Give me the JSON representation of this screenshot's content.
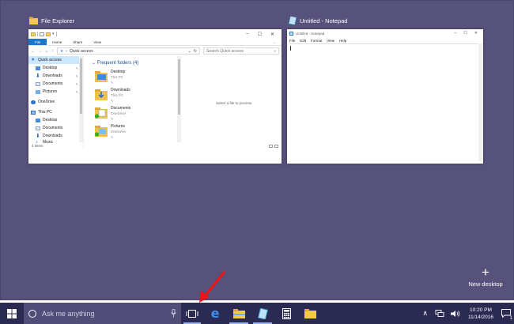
{
  "explorer": {
    "window_title": "File Explorer",
    "ribbon_tabs": [
      "File",
      "Home",
      "Share",
      "View"
    ],
    "address": "Quick access",
    "search_placeholder": "Search Quick access",
    "nav_items": [
      {
        "label": "Quick access",
        "icon": "star-icon",
        "pin": false,
        "selected": true,
        "level": 0
      },
      {
        "label": "Desktop",
        "icon": "desktop-folder-icon",
        "pin": true,
        "selected": false,
        "level": 1
      },
      {
        "label": "Downloads",
        "icon": "downloads-icon",
        "pin": true,
        "selected": false,
        "level": 1
      },
      {
        "label": "Documents",
        "icon": "documents-icon",
        "pin": true,
        "selected": false,
        "level": 1
      },
      {
        "label": "Pictures",
        "icon": "pictures-icon",
        "pin": true,
        "selected": false,
        "level": 1
      },
      {
        "label": "OneDrive",
        "icon": "onedrive-icon",
        "pin": false,
        "selected": false,
        "level": 0
      },
      {
        "label": "This PC",
        "icon": "computer-icon",
        "pin": false,
        "selected": false,
        "level": 0
      },
      {
        "label": "Desktop",
        "icon": "desktop-folder-icon",
        "pin": false,
        "selected": false,
        "level": 1
      },
      {
        "label": "Documents",
        "icon": "documents-icon",
        "pin": false,
        "selected": false,
        "level": 1
      },
      {
        "label": "Downloads",
        "icon": "downloads-icon",
        "pin": false,
        "selected": false,
        "level": 1
      },
      {
        "label": "Music",
        "icon": "music-icon",
        "pin": false,
        "selected": false,
        "level": 1
      }
    ],
    "frequent_header": "Frequent folders (4)",
    "frequent_folders": [
      {
        "name": "Desktop",
        "location": "This PC",
        "synced": false
      },
      {
        "name": "Downloads",
        "location": "This PC",
        "synced": false
      },
      {
        "name": "Documents",
        "location": "OneDrive",
        "synced": true
      },
      {
        "name": "Pictures",
        "location": "OneDrive",
        "synced": true
      }
    ],
    "preview_text": "Select a file to preview.",
    "status_text": "4 items"
  },
  "notepad": {
    "window_title": "Untitled - Notepad",
    "inner_title": "Untitled - Notepad",
    "menu": [
      "File",
      "Edit",
      "Format",
      "View",
      "Help"
    ]
  },
  "new_desktop": {
    "label": "New desktop",
    "icon": "plus-icon"
  },
  "taskbar": {
    "search_placeholder": "Ask me anything",
    "buttons": [
      {
        "name": "start-button",
        "icon": "windows-logo-icon"
      },
      {
        "name": "task-view-button",
        "icon": "task-view-icon",
        "active": true
      },
      {
        "name": "edge-button",
        "icon": "edge-icon"
      },
      {
        "name": "file-explorer-button",
        "icon": "folder-icon",
        "active": true
      },
      {
        "name": "notepad-button",
        "icon": "notepad-icon",
        "active": true
      },
      {
        "name": "calculator-button",
        "icon": "calculator-icon"
      },
      {
        "name": "file-explorer-button-2",
        "icon": "folder-icon"
      }
    ],
    "time": "10:20 PM",
    "date": "11/14/2016",
    "notification_count": "1"
  },
  "colors": {
    "desktop_bg": "#57527c",
    "taskbar_bg": "#2b2a52",
    "search_bg": "#504d78",
    "accent": "#1979ca",
    "annotation_arrow": "#e8151b"
  }
}
